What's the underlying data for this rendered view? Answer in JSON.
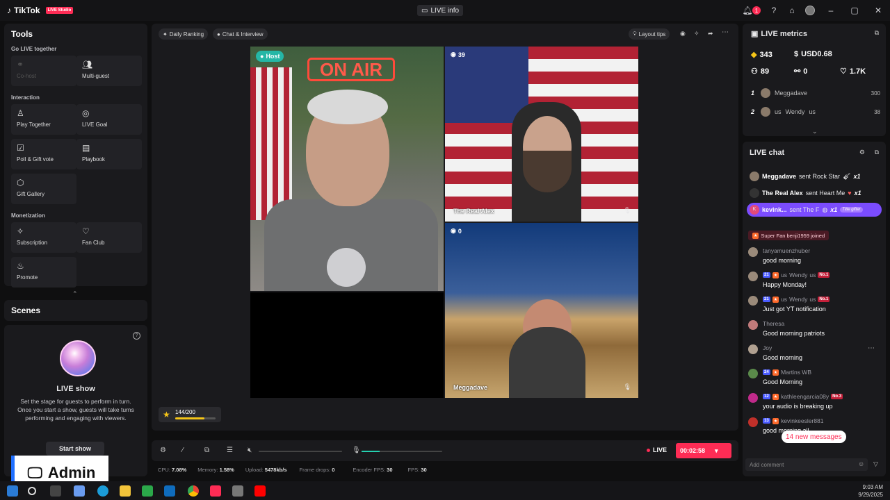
{
  "app": {
    "brand": "TikTok",
    "badge": "LIVE Studio",
    "live_info": "LIVE info",
    "notifications": "1"
  },
  "tools": {
    "title": "Tools",
    "sections": [
      {
        "label": "Go LIVE together",
        "items": [
          {
            "label": "Co-host",
            "icon": "link-icon",
            "disabled": true
          },
          {
            "label": "Multi-guest",
            "icon": "group-icon"
          }
        ]
      },
      {
        "label": "Interaction",
        "items": [
          {
            "label": "Play Together",
            "icon": "joystick-icon"
          },
          {
            "label": "LIVE Goal",
            "icon": "target-icon"
          },
          {
            "label": "Poll & Gift vote",
            "icon": "poll-icon"
          },
          {
            "label": "Playbook",
            "icon": "book-icon"
          },
          {
            "label": "Gift Gallery",
            "icon": "gift-icon"
          }
        ]
      },
      {
        "label": "Monetization",
        "items": [
          {
            "label": "Subscription",
            "icon": "subscription-icon"
          },
          {
            "label": "Fan Club",
            "icon": "heart-icon"
          },
          {
            "label": "Promote",
            "icon": "flame-icon"
          }
        ]
      }
    ]
  },
  "scenes": {
    "title": "Scenes"
  },
  "liveshow": {
    "title": "LIVE show",
    "description": "Set the stage for guests to perform in turn. Once you start a show, guests will take turns performing and engaging with viewers.",
    "button": "Start show"
  },
  "overlay": {
    "admin": "Admin"
  },
  "stage": {
    "chips": {
      "daily_ranking": "Daily Ranking",
      "chat_interview": "Chat & Interview",
      "layout_tips": "Layout tips"
    },
    "host_label": "Host",
    "sign": "ON AIR",
    "guests": [
      {
        "name": "The Real Alex",
        "count": "39"
      },
      {
        "name": "Meggadave",
        "count": "0"
      }
    ],
    "progress": {
      "text": "144/200",
      "fraction": 0.72
    }
  },
  "controls": {
    "live_label": "LIVE",
    "timer": "00:02:58",
    "mic_level": 0.22
  },
  "stats": [
    {
      "label": "CPU:",
      "value": "7.08%"
    },
    {
      "label": "Memory:",
      "value": "1.58%"
    },
    {
      "label": "Upload:",
      "value": "5478kb/s"
    },
    {
      "label": "Frame drops:",
      "value": "0"
    },
    {
      "label": "Encoder FPS:",
      "value": "30"
    },
    {
      "label": "FPS:",
      "value": "30"
    }
  ],
  "metrics": {
    "title": "LIVE metrics",
    "values": {
      "coins": "343",
      "usd": "USD0.68",
      "viewers": "89",
      "shares": "0",
      "likes": "1.7K"
    },
    "ranking": [
      {
        "rank": "1",
        "name": "Meggadave",
        "prefix": "",
        "suffix": "",
        "value": "300"
      },
      {
        "rank": "2",
        "name": "Wendy",
        "prefix": "us",
        "suffix": "us",
        "value": "38"
      }
    ]
  },
  "chat": {
    "title": "LIVE chat",
    "gifts": [
      {
        "name": "Meggadave",
        "text": "sent Rock Star",
        "count": "x1"
      },
      {
        "name": "The Real Alex",
        "text": "sent Heart Me",
        "count": "x1"
      },
      {
        "name": "kevink...",
        "text": "sent The F",
        "count": "x1",
        "tag": "Title gifter"
      }
    ],
    "joined": "Super Fan benji1959 joined",
    "messages": [
      {
        "name": "tanyamuenzhuber",
        "text": "good morning",
        "level": "",
        "fan": false,
        "badge": ""
      },
      {
        "name": "Wendy",
        "prefix": "us",
        "suffix": "us",
        "text": "Happy Monday!",
        "level": "21",
        "fan": true,
        "badge": "No.1"
      },
      {
        "name": "Wendy",
        "prefix": "us",
        "suffix": "us",
        "text": "Just got YT notification",
        "level": "21",
        "fan": true,
        "badge": "No.1"
      },
      {
        "name": "Theresa",
        "text": "Good morning patriots",
        "level": "",
        "fan": false,
        "badge": ""
      },
      {
        "name": "Joy",
        "text": "Good morning",
        "level": "",
        "fan": false,
        "badge": ""
      },
      {
        "name": "Martins  WB",
        "text": "Good Morning",
        "level": "24",
        "fan": true,
        "badge": ""
      },
      {
        "name": "kathleengarcia08y",
        "text": "your audio is breaking up",
        "level": "12",
        "fan": true,
        "badge": "No.3"
      },
      {
        "name": "kevinkeesler881",
        "text": "good morning all",
        "level": "13",
        "fan": true,
        "badge": ""
      }
    ],
    "new_messages": "14 new messages",
    "add_comment": "Add comment"
  },
  "taskbar": {
    "time": "9:03 AM",
    "date": "9/29/2025"
  }
}
